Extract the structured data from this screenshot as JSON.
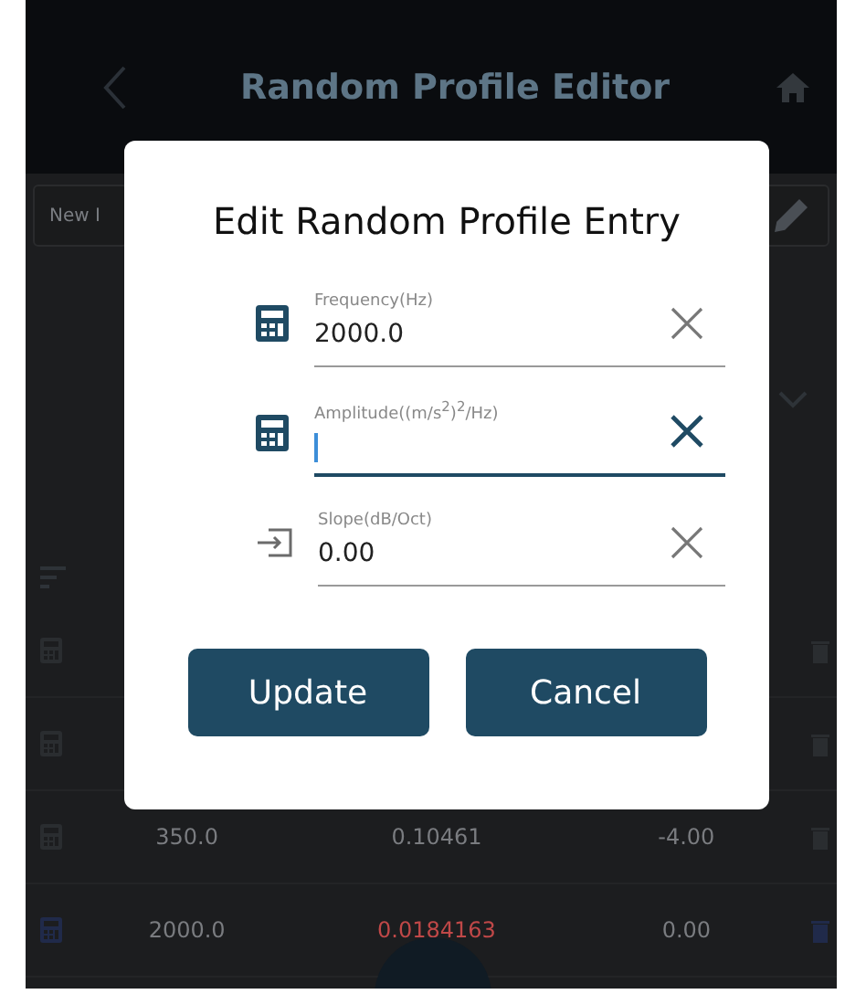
{
  "app_bar": {
    "title": "Random Profile Editor"
  },
  "toolbar": {
    "new_button": "New I"
  },
  "rows": [
    {
      "kind": "covered"
    },
    {
      "kind": "covered"
    },
    {
      "kind": "entry",
      "frequency": "350.0",
      "amplitude": "0.10461",
      "slope": "-4.00",
      "highlighted": false
    },
    {
      "kind": "entry",
      "frequency": "2000.0",
      "amplitude": "0.0184163",
      "slope": "0.00",
      "highlighted": true
    }
  ],
  "dialog": {
    "title": "Edit Random Profile Entry",
    "fields": [
      {
        "kind": "calculator",
        "label": "Frequency(Hz)",
        "value": "2000.0",
        "focused": false
      },
      {
        "kind": "calculator",
        "label": "Amplitude((m/s$^{2}$)$^{2}$/Hz)",
        "focused": true
      },
      {
        "kind": "input",
        "label": "Slope(dB/Oct)",
        "value": "0.00",
        "focused": false
      }
    ],
    "buttons": [
      "Update",
      "Cancel"
    ]
  }
}
